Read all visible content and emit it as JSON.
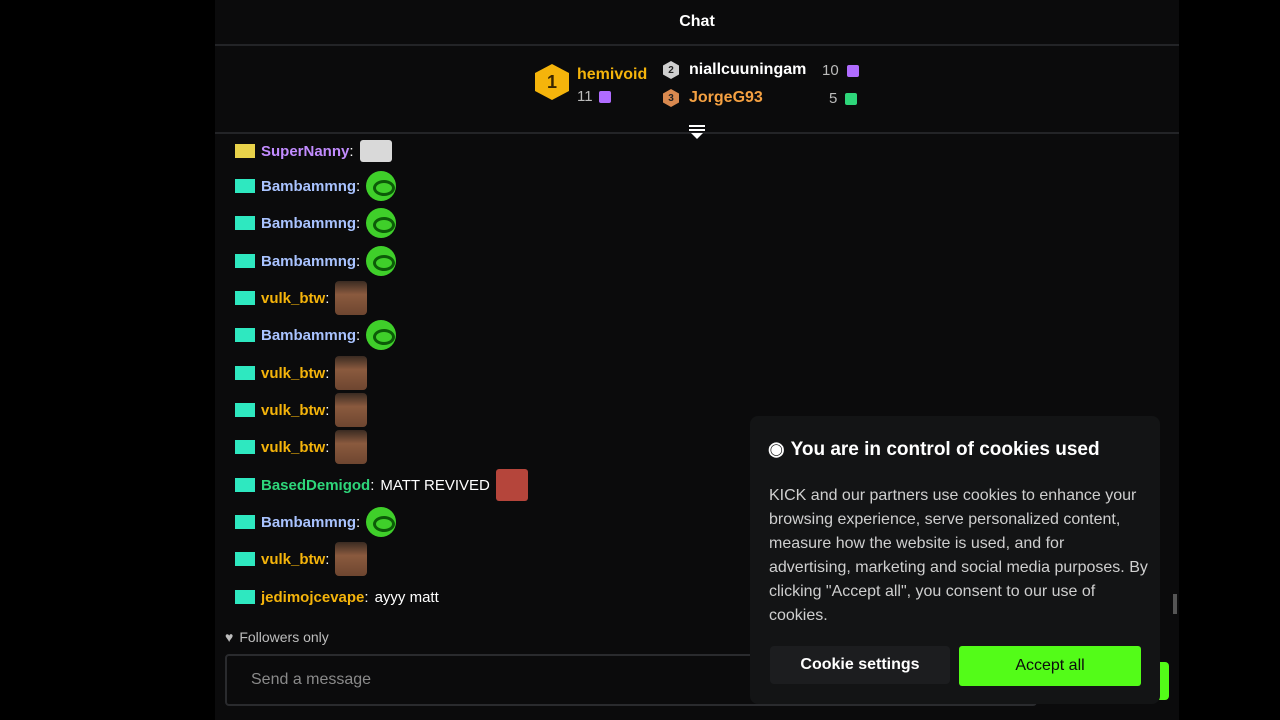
{
  "header": {
    "title": "Chat"
  },
  "leaderboard": {
    "first": {
      "rank": "1",
      "name": "hemivoid",
      "count": "11"
    },
    "second": {
      "rank": "2",
      "name": "niallcuuningam",
      "count": "10"
    },
    "third": {
      "rank": "3",
      "name": "JorgeG93",
      "count": "5"
    }
  },
  "messages": [
    {
      "user": "SuperNanny",
      "color": "#c28cff",
      "emote": "eyes-emote"
    },
    {
      "user": "Bambammng",
      "color": "#a9c3ff",
      "emote": "frog-emote"
    },
    {
      "user": "Bambammng",
      "color": "#a9c3ff",
      "emote": "frog-emote"
    },
    {
      "user": "Bambammng",
      "color": "#a9c3ff",
      "emote": "frog-emote"
    },
    {
      "user": "vulk_btw",
      "color": "#f5b40b",
      "emote": "face-emote"
    },
    {
      "user": "Bambammng",
      "color": "#a9c3ff",
      "emote": "frog-emote"
    },
    {
      "user": "vulk_btw",
      "color": "#f5b40b",
      "emote": "face-emote"
    },
    {
      "user": "vulk_btw",
      "color": "#f5b40b",
      "emote": "face-emote"
    },
    {
      "user": "vulk_btw",
      "color": "#f5b40b",
      "emote": "face-emote"
    },
    {
      "user": "BasedDemigod",
      "color": "#2ed67a",
      "text": "MATT REVIVED",
      "emote": "red-face-emote"
    },
    {
      "user": "Bambammng",
      "color": "#a9c3ff",
      "emote": "frog-emote"
    },
    {
      "user": "vulk_btw",
      "color": "#f5b40b",
      "emote": "face-emote"
    },
    {
      "user": "jedimojcevape",
      "color": "#f5b40b",
      "text": "ayyy matt"
    }
  ],
  "chat": {
    "followers_only": "Followers only",
    "input_placeholder": "Send a message"
  },
  "cookie": {
    "title": "You are in control of cookies used",
    "body": "KICK and our partners use cookies to enhance your browsing experience, serve personalized content, measure how the website is used, and for advertising, marketing and social media purposes. By clicking \"Accept all\", you consent to our use of cookies.",
    "settings_label": "Cookie settings",
    "accept_label": "Accept all"
  },
  "colors": {
    "accent": "#53fc18",
    "gold": "#f5b40b",
    "panel": "#0b0b0c"
  }
}
